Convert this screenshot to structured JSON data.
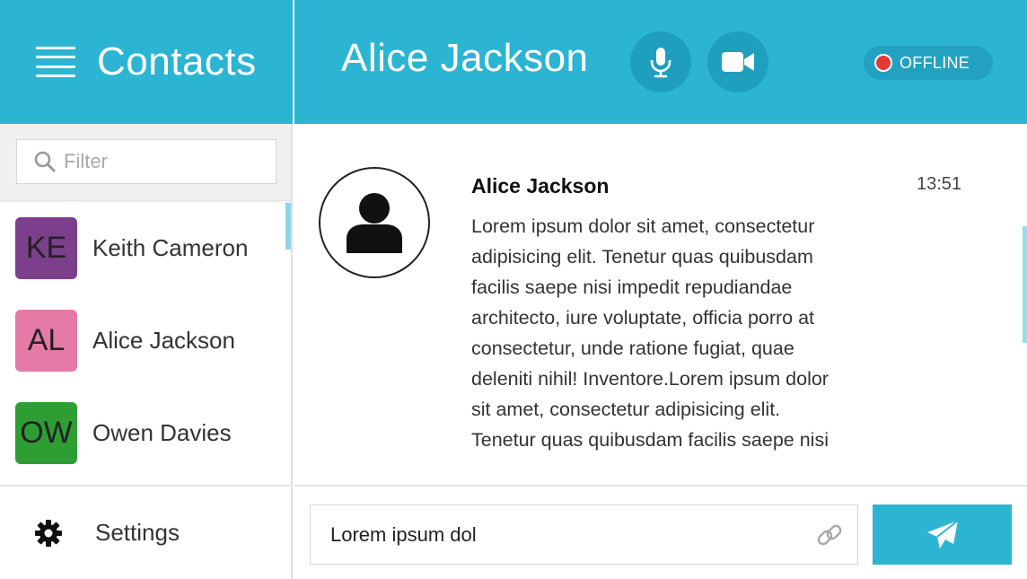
{
  "sidebar": {
    "title": "Contacts",
    "filter": {
      "placeholder": "Filter",
      "value": ""
    },
    "contacts": [
      {
        "initials": "KE",
        "name": "Keith Cameron",
        "color": "#7b3f8c"
      },
      {
        "initials": "AL",
        "name": "Alice Jackson",
        "color": "#e67aa6"
      },
      {
        "initials": "OW",
        "name": "Owen Davies",
        "color": "#2e9e34"
      }
    ],
    "settings_label": "Settings"
  },
  "chat": {
    "title": "Alice Jackson",
    "status": "OFFLINE",
    "status_color": "#e53935",
    "accent_color": "#2bb5d3",
    "icons": {
      "mic": "microphone-icon",
      "video": "video-camera-icon",
      "attach": "link-icon",
      "send": "paper-plane-icon",
      "menu": "hamburger-menu-icon",
      "filter": "search-icon",
      "settings": "gear-icon",
      "avatar": "user-silhouette-icon"
    },
    "message": {
      "sender": "Alice Jackson",
      "time": "13:51",
      "text": "Lorem ipsum dolor sit amet, consectetur adipisicing elit. Tenetur quas quibusdam facilis saepe nisi impedit repudiandae architecto, iure voluptate, officia porro at consectetur, unde ratione fugiat, quae deleniti nihil! Inventore.Lorem ipsum dolor sit amet, consectetur adipisicing elit. Tenetur quas quibusdam facilis saepe nisi"
    },
    "composer": {
      "value": "Lorem ipsum dol"
    }
  }
}
